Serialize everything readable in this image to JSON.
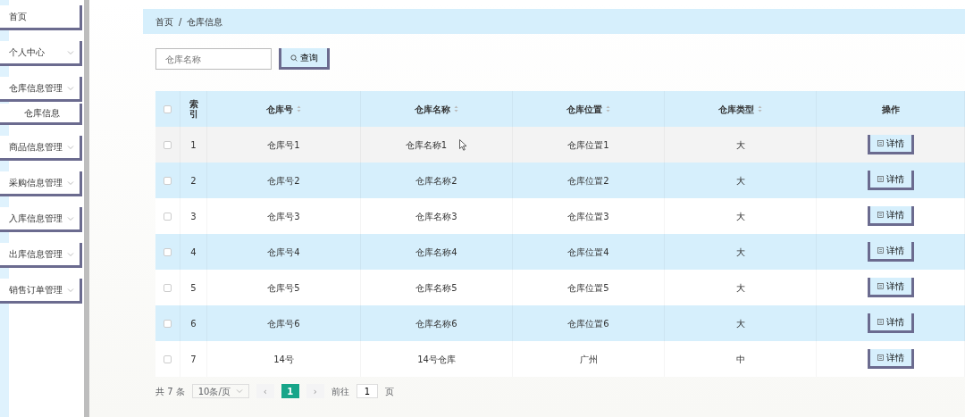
{
  "sidebar": {
    "items": [
      {
        "label": "首页",
        "expandable": false
      },
      {
        "label": "个人中心",
        "expandable": true
      },
      {
        "label": "仓库信息管理",
        "expandable": true,
        "children": [
          {
            "label": "仓库信息",
            "expandable": false
          }
        ]
      },
      {
        "label": "商品信息管理",
        "expandable": true
      },
      {
        "label": "采购信息管理",
        "expandable": true
      },
      {
        "label": "入库信息管理",
        "expandable": true
      },
      {
        "label": "出库信息管理",
        "expandable": true
      },
      {
        "label": "销售订单管理",
        "expandable": true
      }
    ]
  },
  "breadcrumb": {
    "separator": "/",
    "items": [
      "首页",
      "仓库信息"
    ]
  },
  "search": {
    "placeholder": "仓库名称",
    "button": "查询"
  },
  "table": {
    "select_all_checked": false,
    "columns": [
      {
        "label": "索引",
        "sortable": false
      },
      {
        "label": "仓库号",
        "sortable": true
      },
      {
        "label": "仓库名称",
        "sortable": true
      },
      {
        "label": "仓库位置",
        "sortable": true
      },
      {
        "label": "仓库类型",
        "sortable": true
      },
      {
        "label": "操作",
        "sortable": false
      }
    ],
    "rows": [
      {
        "checked": false,
        "hovered": true,
        "cells": [
          "1",
          "仓库号1",
          "仓库名称1",
          "仓库位置1",
          "大"
        ],
        "action": "详情"
      },
      {
        "checked": false,
        "hovered": false,
        "cells": [
          "2",
          "仓库号2",
          "仓库名称2",
          "仓库位置2",
          "大"
        ],
        "action": "详情"
      },
      {
        "checked": false,
        "hovered": false,
        "cells": [
          "3",
          "仓库号3",
          "仓库名称3",
          "仓库位置3",
          "大"
        ],
        "action": "详情"
      },
      {
        "checked": false,
        "hovered": false,
        "cells": [
          "4",
          "仓库号4",
          "仓库名称4",
          "仓库位置4",
          "大"
        ],
        "action": "详情"
      },
      {
        "checked": false,
        "hovered": false,
        "cells": [
          "5",
          "仓库号5",
          "仓库名称5",
          "仓库位置5",
          "大"
        ],
        "action": "详情"
      },
      {
        "checked": false,
        "hovered": false,
        "cells": [
          "6",
          "仓库号6",
          "仓库名称6",
          "仓库位置6",
          "大"
        ],
        "action": "详情"
      },
      {
        "checked": false,
        "hovered": false,
        "cells": [
          "7",
          "14号",
          "14号仓库",
          "广州",
          "中"
        ],
        "action": "详情"
      }
    ]
  },
  "pagination": {
    "total": "共 7 条",
    "page_size": "10条/页",
    "prev": "‹",
    "pages": [
      {
        "label": "1",
        "selected": true
      }
    ],
    "next": "›",
    "goto_label": "前往",
    "goto_value": "1",
    "goto_suffix": "页"
  }
}
